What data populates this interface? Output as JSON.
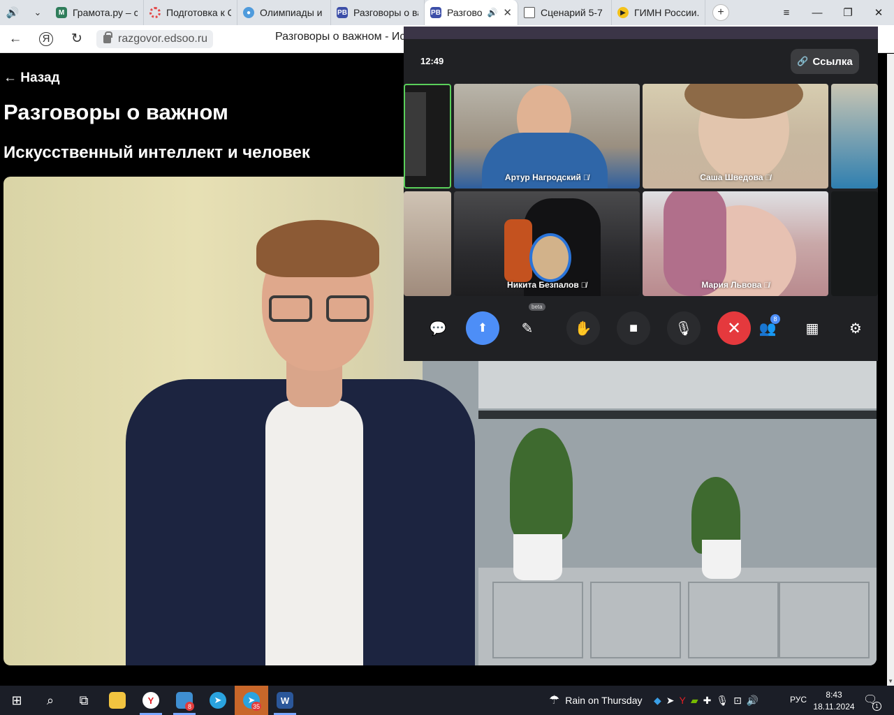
{
  "tabs": [
    {
      "label": "Грамота.ру – с",
      "favicon": "gramota-icon"
    },
    {
      "label": "Подготовка к С",
      "favicon": "circle-icon"
    },
    {
      "label": "Олимпиады и",
      "favicon": "olympiad-icon"
    },
    {
      "label": "Разговоры о ва",
      "favicon": "rv-icon"
    },
    {
      "label": "Разговор",
      "favicon": "rv-icon",
      "active": true
    },
    {
      "label": "Сценарий 5-7",
      "favicon": "document-icon"
    },
    {
      "label": "ГИМН России.",
      "favicon": "play-icon"
    }
  ],
  "address": {
    "url": "razgovor.edsoo.ru",
    "page_title": "Разговоры о важном - Ис"
  },
  "page": {
    "back": "← Назад",
    "title": "Разговоры о важном",
    "subtitle": "Искусственный интеллект и человек"
  },
  "call": {
    "time": "12:49",
    "link_label": "Ссылка",
    "participants": [
      {
        "name": "Артур Нагродский"
      },
      {
        "name": "Саша Шведова"
      },
      {
        "name": "Никита Безпалов"
      },
      {
        "name": "Мария Львова"
      }
    ],
    "beta_label": "beta",
    "participants_count": "8"
  },
  "taskbar": {
    "telegram_badge": "8",
    "telegram2_badge": "35",
    "weather": "Rain on Thursday",
    "language": "РУС",
    "time": "8:43",
    "date": "18.11.2024",
    "notifications": "1"
  },
  "colors": {
    "accent_blue": "#4d8ef7",
    "hangup_red": "#e5393d",
    "active_tile_border": "#5ad05a"
  }
}
